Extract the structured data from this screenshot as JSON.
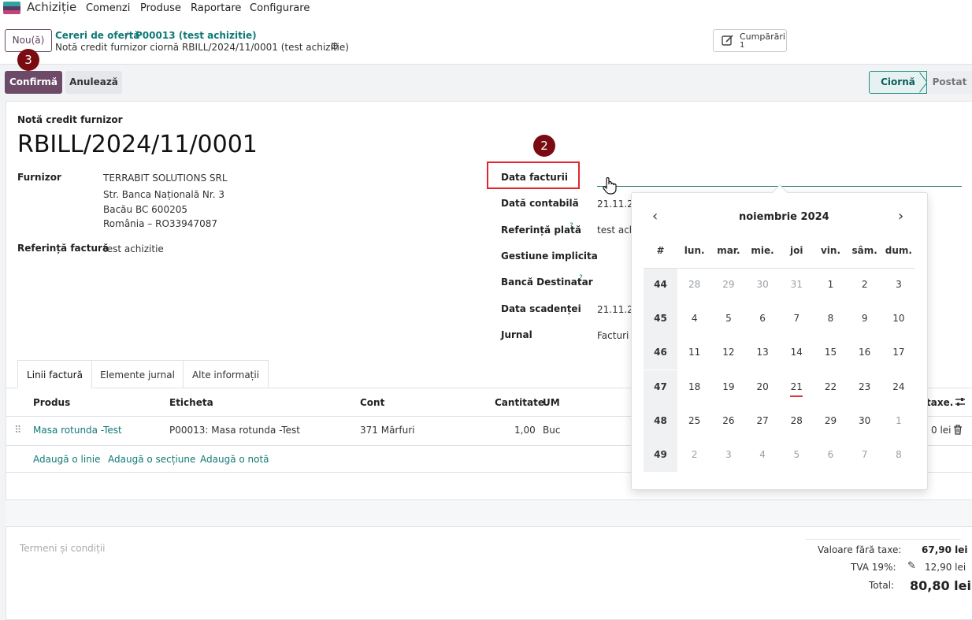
{
  "topnav": {
    "app_name": "Achiziție",
    "menu": [
      "Comenzi",
      "Produse",
      "Raportare",
      "Configurare"
    ]
  },
  "control": {
    "new_button": "Nou(ă)",
    "breadcrumb": [
      "Cereri de ofertă",
      "P00013 (test achizitie)"
    ],
    "breadcrumb_separator": "/",
    "record_title": "Notă credit furnizor ciornă RBILL/2024/11/0001 (test achizitie)",
    "purchases_button": {
      "label": "Cumpărări",
      "count": "1"
    }
  },
  "statusbar": {
    "confirm": "Confirmă",
    "cancel": "Anulează",
    "stages": [
      "Ciornă",
      "Postat"
    ]
  },
  "sheet": {
    "doc_type": "Notă credit furnizor",
    "name": "RBILL/2024/11/0001",
    "left_fields": {
      "vendor_label": "Furnizor",
      "vendor_lines": [
        "TERRABIT SOLUTIONS SRL",
        "Str. Banca Națională Nr. 3",
        "Bacău BC 600205",
        "România – RO33947087"
      ],
      "ref_label": "Referință factură",
      "ref_value": "test achizitie"
    },
    "right_fields": [
      {
        "label": "Data facturii",
        "value": ""
      },
      {
        "label": "Dată contabilă",
        "value": "21.11.20"
      },
      {
        "label": "Referință plată",
        "value": "test ach",
        "help": "?"
      },
      {
        "label": "Gestiune implicita",
        "value": ""
      },
      {
        "label": "Bancă Destinatar",
        "value": "",
        "help": "?"
      },
      {
        "label": "Data scadenței",
        "value": "21.11.20"
      },
      {
        "label": "Jurnal",
        "value": "Facturi f"
      }
    ],
    "tabs": [
      "Linii factură",
      "Elemente jurnal",
      "Alte informații"
    ],
    "table": {
      "headers": [
        "Produs",
        "Eticheta",
        "Cont",
        "Cantitate",
        "UM",
        "taxe."
      ],
      "rows": [
        {
          "product": "Masa rotunda -Test",
          "label": "P00013: Masa rotunda -Test",
          "account": "371 Mărfuri",
          "qty": "1,00",
          "uom": "Buc",
          "subtotal": "0 lei"
        }
      ],
      "add_links": [
        "Adaugă o linie",
        "Adaugă o secțiune",
        "Adaugă o notă"
      ]
    },
    "terms_placeholder": "Termeni și condiții",
    "totals": [
      {
        "label": "Valoare fără taxe:",
        "value": "67,90 lei"
      },
      {
        "label": "TVA 19%:",
        "value": "12,90 lei"
      },
      {
        "label": "Total:",
        "value": "80,80 lei"
      }
    ]
  },
  "datepicker": {
    "month": "noiembrie 2024",
    "headers": [
      "#",
      "lun.",
      "mar.",
      "mie.",
      "joi",
      "vin.",
      "sâm.",
      "dum."
    ],
    "weeks": [
      {
        "week": "44",
        "days": [
          "28",
          "29",
          "30",
          "31",
          "1",
          "2",
          "3"
        ]
      },
      {
        "week": "45",
        "days": [
          "4",
          "5",
          "6",
          "7",
          "8",
          "9",
          "10"
        ]
      },
      {
        "week": "46",
        "days": [
          "11",
          "12",
          "13",
          "14",
          "15",
          "16",
          "17"
        ]
      },
      {
        "week": "47",
        "days": [
          "18",
          "19",
          "20",
          "21",
          "22",
          "23",
          "24"
        ]
      },
      {
        "week": "48",
        "days": [
          "25",
          "26",
          "27",
          "28",
          "29",
          "30",
          "1"
        ]
      },
      {
        "week": "49",
        "days": [
          "2",
          "3",
          "4",
          "5",
          "6",
          "7",
          "8"
        ]
      }
    ]
  },
  "badges": {
    "step2": "2",
    "step3": "3"
  },
  "colors": {
    "brand": "#6d4a67",
    "link": "#0f7a76",
    "badge": "#7a0b10",
    "highlight": "#e2262b"
  }
}
